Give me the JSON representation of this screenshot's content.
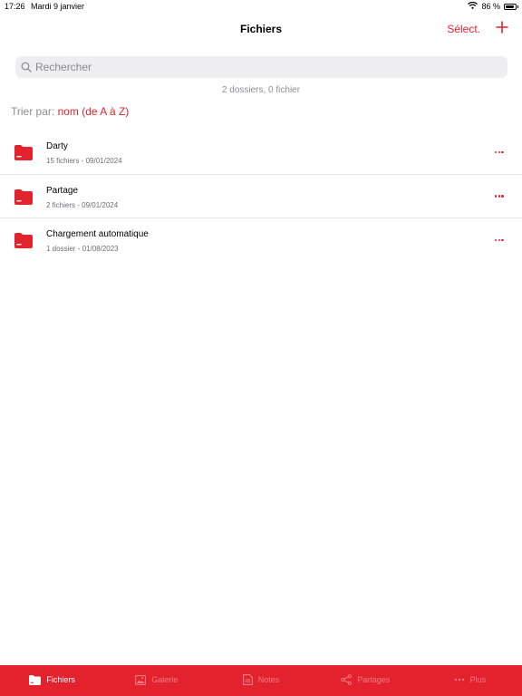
{
  "status_bar": {
    "time": "17:26",
    "date": "Mardi 9 janvier",
    "battery_text": "86 %",
    "battery_level": 0.86
  },
  "nav": {
    "title": "Fichiers",
    "select_label": "Sélect.",
    "add_icon": "plus-icon"
  },
  "search": {
    "placeholder": "Rechercher",
    "value": ""
  },
  "summary": "2 dossiers, 0 fichier",
  "sort": {
    "label": "Trier par:",
    "value": "nom (de A à Z)"
  },
  "files": [
    {
      "name": "Darty",
      "meta": "15 fichiers - 09/01/2024",
      "icon": "folder-icon"
    },
    {
      "name": "Partage",
      "meta": "2 fichiers - 09/01/2024",
      "icon": "folder-icon"
    },
    {
      "name": "Chargement automatique",
      "meta": "1 dossier - 01/08/2023",
      "icon": "folder-icon"
    }
  ],
  "tabs": [
    {
      "label": "Fichiers",
      "icon": "folder-icon",
      "active": true
    },
    {
      "label": "Galerie",
      "icon": "image-icon",
      "active": false
    },
    {
      "label": "Notes",
      "icon": "note-icon",
      "active": false
    },
    {
      "label": "Partages",
      "icon": "share-icon",
      "active": false
    },
    {
      "label": "Plus",
      "icon": "more-icon",
      "active": false
    }
  ],
  "colors": {
    "accent": "#e4222d",
    "secondary_text": "#8e8e93",
    "search_bg": "#eeeef0"
  }
}
